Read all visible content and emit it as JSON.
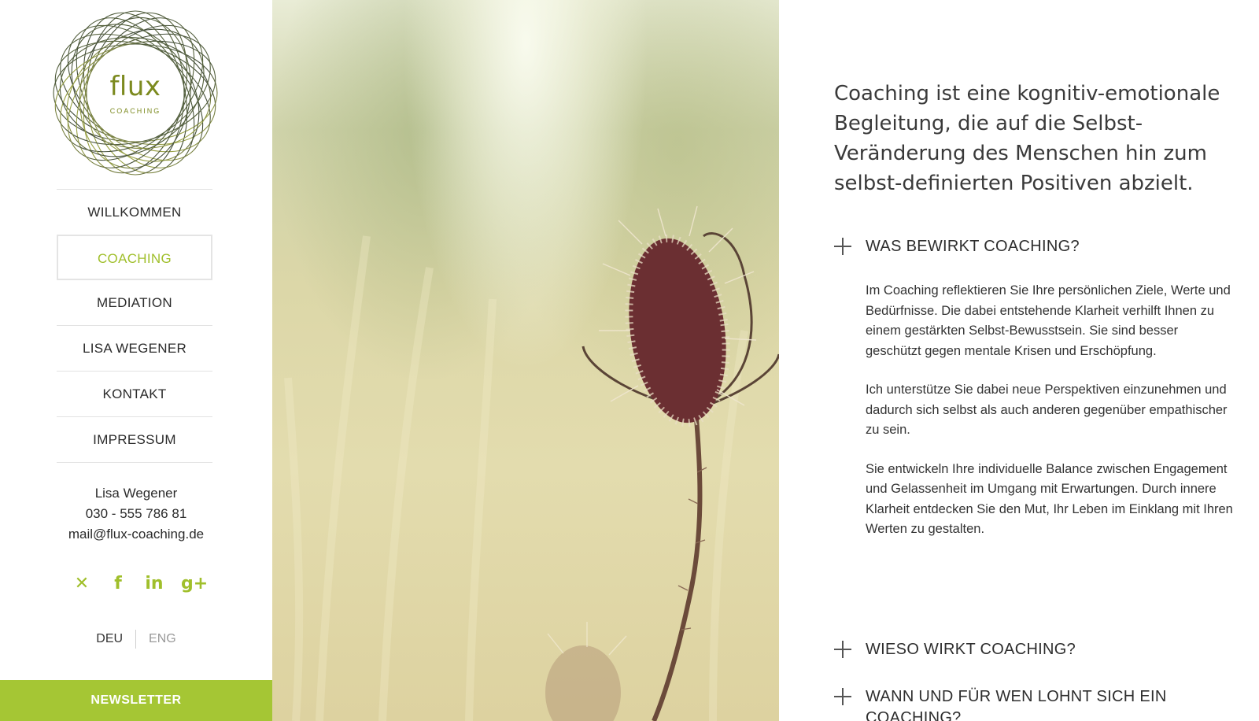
{
  "brand": {
    "logo_word": "flux",
    "logo_sub": "COACHING",
    "accent_color": "#a5c634"
  },
  "nav": {
    "items": [
      {
        "label": "WILLKOMMEN"
      },
      {
        "label": "COACHING",
        "active": true
      },
      {
        "label": "MEDIATION"
      },
      {
        "label": "LISA WEGENER"
      },
      {
        "label": "KONTAKT"
      },
      {
        "label": "IMPRESSUM"
      }
    ]
  },
  "contact": {
    "name": "Lisa Wegener",
    "phone": "030 - 555 786 81",
    "email": "mail@flux-coaching.de"
  },
  "social": {
    "icons": [
      "xing-icon",
      "facebook-icon",
      "linkedin-icon",
      "google-plus-icon"
    ],
    "glyphs": [
      "✕",
      "f",
      "in",
      "g+"
    ]
  },
  "language": {
    "current": "DEU",
    "other": "ENG"
  },
  "newsletter": {
    "label": "NEWSLETTER"
  },
  "main": {
    "intro": "Coaching ist eine kognitiv-emotionale Begleitung, die auf die Selbst-Veränderung des Menschen hin zum selbst-definierten Positiven abzielt.",
    "sections": [
      {
        "title": "WAS BEWIRKT COACHING?",
        "expanded": true,
        "paragraphs": [
          "Im Coaching reflektieren Sie Ihre persönlichen Ziele, Werte und Bedürfnisse. Die dabei entstehende Klarheit verhilft Ihnen zu einem gestärkten Selbst-Bewusstsein. Sie sind besser geschützt gegen mentale Krisen und Erschöpfung.",
          "Ich unterstütze Sie dabei neue Perspektiven einzunehmen und dadurch sich selbst als auch anderen gegenüber empathischer zu sein.",
          "Sie entwickeln Ihre individuelle Balance zwischen Engagement und Gelassenheit im Umgang mit Erwartungen. Durch innere Klarheit entdecken Sie den Mut, Ihr Leben im Einklang mit Ihren Werten zu gestalten."
        ]
      },
      {
        "title": "WIESO WIRKT COACHING?",
        "expanded": false
      },
      {
        "title": "WANN UND FÜR WEN LOHNT SICH EIN COACHING?",
        "expanded": false
      }
    ]
  }
}
